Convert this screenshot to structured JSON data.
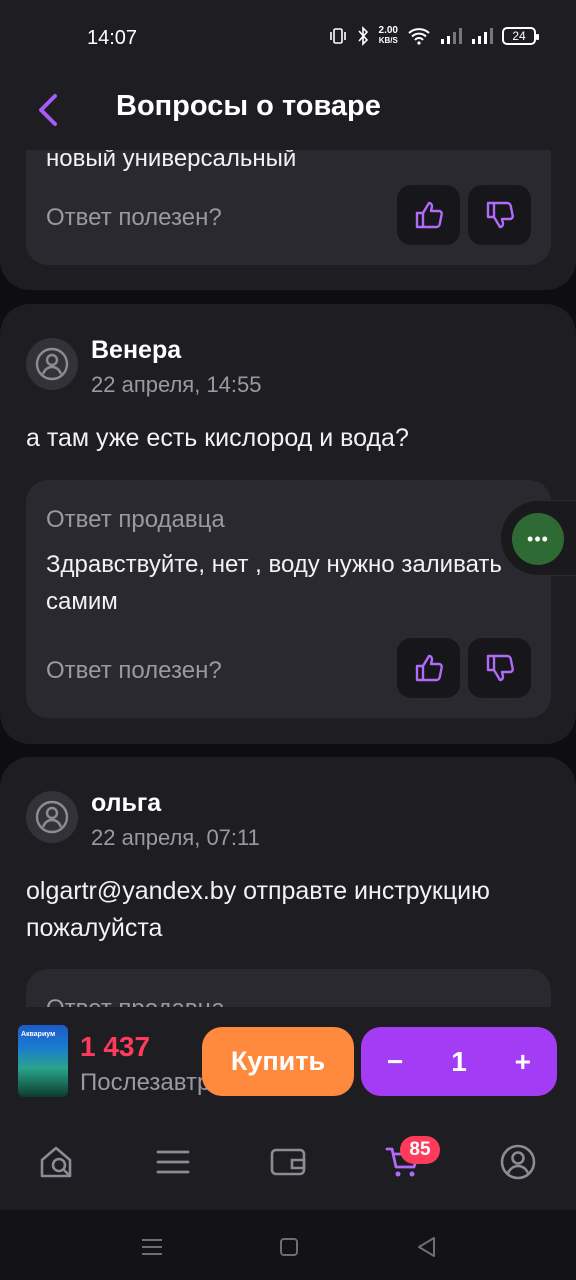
{
  "status": {
    "time": "14:07",
    "net_speed_value": "2.00",
    "net_speed_unit": "KB/S",
    "battery": "24"
  },
  "header": {
    "title": "Вопросы о товаре"
  },
  "top_card": {
    "cut_text": "новый универсальный",
    "useful_label": "Ответ полезен?"
  },
  "questions": [
    {
      "author": "Венера",
      "date": "22 апреля, 14:55",
      "text": "а там уже есть кислород и вода?",
      "answer_label": "Ответ продавца",
      "answer_text": "Здравствуйте, нет , воду нужно заливать самим",
      "useful_label": "Ответ полезен?"
    },
    {
      "author": "ольга",
      "date": "22 апреля, 07:11",
      "text": "olgartr@yandex.by отправте инструкцию пожалуйста",
      "answer_label": "Ответ продавца"
    }
  ],
  "fab": {
    "icon": "more-dots-icon",
    "label": "•••"
  },
  "buybar": {
    "product_thumb_label": "Аквариум",
    "price": "1 437",
    "price_sub": "Послезавтра",
    "buy_label": "Купить",
    "qty_minus": "−",
    "qty_value": "1",
    "qty_plus": "+"
  },
  "tabbar": {
    "items": [
      "home-search-icon",
      "catalog-icon",
      "wallet-icon",
      "cart-icon",
      "profile-icon"
    ],
    "cart_badge": "85"
  },
  "colors": {
    "accent": "#a43cf6",
    "buy": "#ff8a3d",
    "price": "#ff3b5c",
    "card": "#1e1d21",
    "answer_bg": "#2a292f"
  }
}
